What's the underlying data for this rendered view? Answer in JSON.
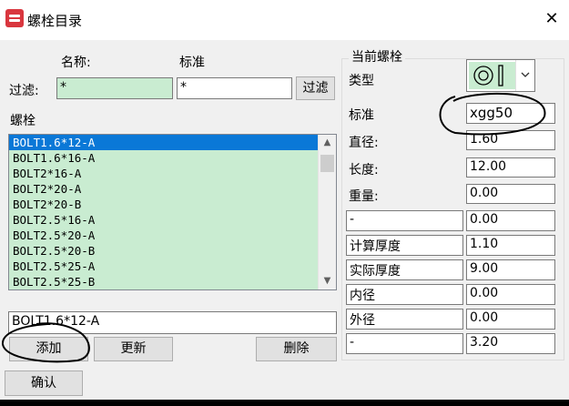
{
  "window": {
    "title": "螺栓目录",
    "close_glyph": "✕"
  },
  "filter": {
    "name_header": "名称:",
    "standard_header": "标准",
    "label": "过滤:",
    "name_value": "*",
    "standard_value": "*",
    "button_label": "过滤"
  },
  "bolt_list": {
    "label": "螺栓",
    "items": [
      "BOLT1.6*12-A",
      "BOLT1.6*16-A",
      "BOLT2*16-A",
      "BOLT2*20-A",
      "BOLT2*20-B",
      "BOLT2.5*16-A",
      "BOLT2.5*20-A",
      "BOLT2.5*20-B",
      "BOLT2.5*25-A",
      "BOLT2.5*25-B"
    ],
    "selected_index": 0,
    "selected_value": "BOLT1.6*12-A"
  },
  "buttons": {
    "add": "添加",
    "update": "更新",
    "delete": "删除",
    "confirm": "确认"
  },
  "current_bolt": {
    "group_title": "当前螺栓",
    "type_label": "类型",
    "standard_label": "标准",
    "standard_value": "xgg50",
    "diameter_label": "直径:",
    "diameter_value": "1.60",
    "length_label": "长度:",
    "length_value": "12.00",
    "weight_label": "重量:",
    "weight_value": "0.00",
    "extra_rows": [
      {
        "label": "-",
        "value": "0.00"
      },
      {
        "label": "计算厚度",
        "value": "1.10"
      },
      {
        "label": "实际厚度",
        "value": "9.00"
      },
      {
        "label": "内径",
        "value": "0.00"
      },
      {
        "label": "外径",
        "value": "0.00"
      },
      {
        "label": "-",
        "value": "3.20"
      }
    ]
  },
  "colors": {
    "list_background": "#c9ecd1",
    "selection": "#0a78d7",
    "app_icon": "#d9363e"
  }
}
